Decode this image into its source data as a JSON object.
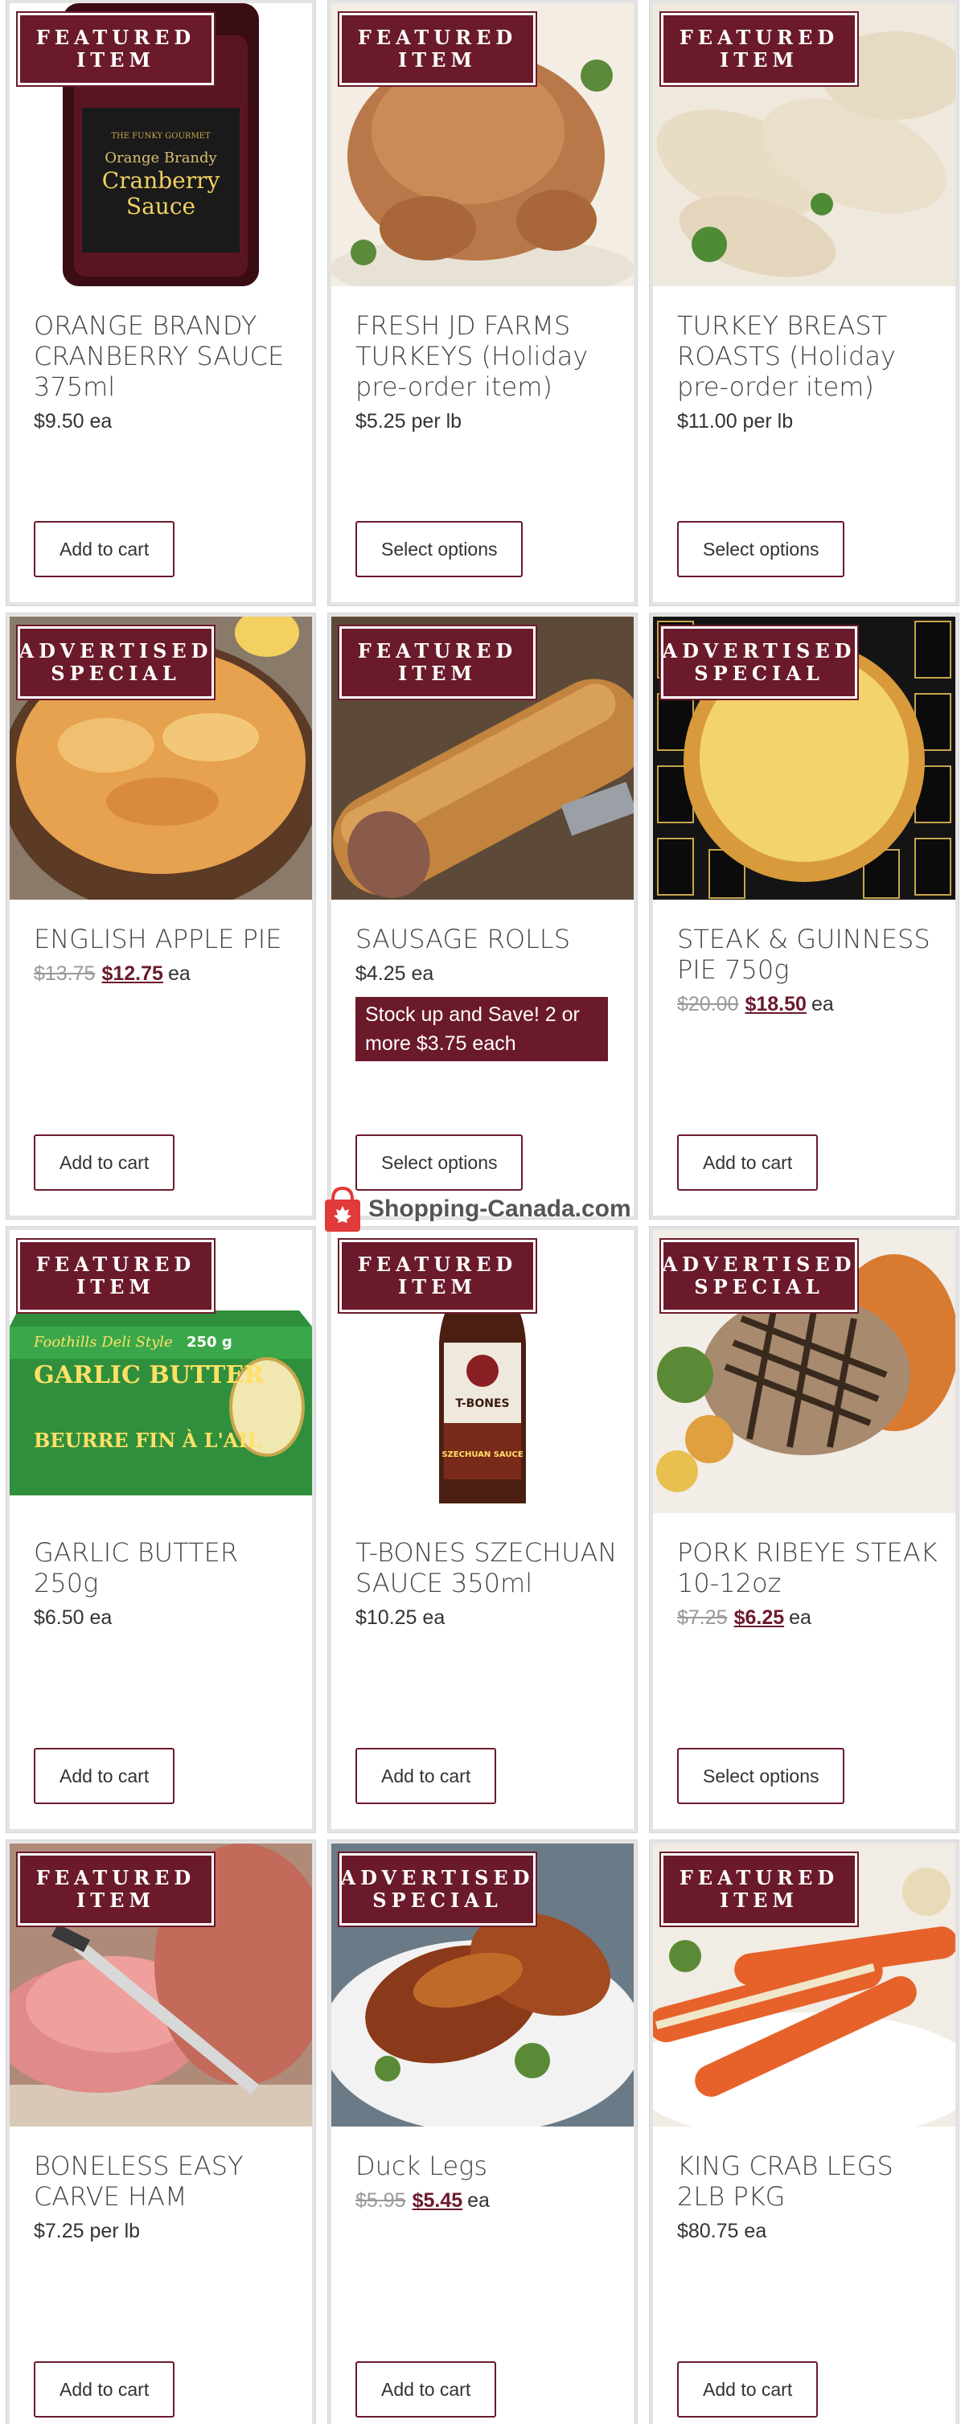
{
  "products": [
    {
      "badge": [
        "FEATURED",
        "ITEM"
      ],
      "title": "ORANGE BRANDY CRANBERRY SAUCE 375ml",
      "price": "$9.50 ea",
      "button": "Add to cart",
      "image": "cranberry-sauce-jar-image",
      "jar_label": [
        "THE FUNKY GOURMET",
        "Orange Brandy",
        "Cranberry",
        "Sauce"
      ]
    },
    {
      "badge": [
        "FEATURED",
        "ITEM"
      ],
      "title": "FRESH JD FARMS TURKEYS (Holiday pre-order item)",
      "price": "$5.25 per lb",
      "button": "Select options",
      "image": "roast-turkey-image"
    },
    {
      "badge": [
        "FEATURED",
        "ITEM"
      ],
      "title": "TURKEY BREAST ROASTS (Holiday pre-order item)",
      "price": "$11.00 per lb",
      "button": "Select options",
      "image": "turkey-breast-roast-image"
    },
    {
      "badge": [
        "ADVERTISED",
        "SPECIAL"
      ],
      "title": "ENGLISH APPLE PIE",
      "old_price": "$13.75",
      "sale_price": "$12.75",
      "unit": "ea",
      "button": "Add to cart",
      "image": "apple-pie-image"
    },
    {
      "badge": [
        "FEATURED",
        "ITEM"
      ],
      "title": "SAUSAGE ROLLS",
      "price": "$4.25 ea",
      "promo": "Stock up and Save! 2 or more $3.75 each",
      "button": "Select options",
      "image": "sausage-roll-image"
    },
    {
      "badge": [
        "ADVERTISED",
        "SPECIAL"
      ],
      "title": "STEAK & GUINNESS PIE 750g",
      "old_price": "$20.00",
      "sale_price": "$18.50",
      "unit": "ea",
      "button": "Add to cart",
      "image": "steak-guinness-pie-image"
    },
    {
      "badge": [
        "FEATURED",
        "ITEM"
      ],
      "title": "GARLIC BUTTER 250g",
      "price": "$6.50 ea",
      "button": "Add to cart",
      "image": "garlic-butter-package-image",
      "package_label": [
        "Foothills Deli Style",
        "GARLIC BUTTER",
        "BEURRE FIN À L'AIL",
        "250 g"
      ]
    },
    {
      "badge": [
        "FEATURED",
        "ITEM"
      ],
      "title": "T-BONES SZECHUAN SAUCE 350ml",
      "price": "$10.25 ea",
      "button": "Add to cart",
      "image": "szechuan-sauce-bottle-image",
      "bottle_label": [
        "T-BONES",
        "SZECHUAN SAUCE"
      ]
    },
    {
      "badge": [
        "ADVERTISED",
        "SPECIAL"
      ],
      "title": "PORK RIBEYE STEAK 10-12oz",
      "old_price": "$7.25",
      "sale_price": "$6.25",
      "unit": "ea",
      "button": "Select options",
      "image": "pork-ribeye-steak-image"
    },
    {
      "badge": [
        "FEATURED",
        "ITEM"
      ],
      "title": "BONELESS EASY CARVE HAM",
      "price": "$7.25 per lb",
      "button": "Add to cart",
      "image": "sliced-ham-image"
    },
    {
      "badge": [
        "ADVERTISED",
        "SPECIAL"
      ],
      "title": "Duck Legs",
      "old_price": "$5.95",
      "sale_price": "$5.45",
      "unit": "ea",
      "button": "Add to cart",
      "image": "duck-legs-image"
    },
    {
      "badge": [
        "FEATURED",
        "ITEM"
      ],
      "title": "KING CRAB LEGS 2LB PKG",
      "price": "$80.75 ea",
      "button": "Add to cart",
      "image": "king-crab-legs-image"
    }
  ],
  "watermark": {
    "text": "Shopping-Canada.com",
    "icon": "shopping-bag-maple-leaf-icon"
  },
  "colors": {
    "brand": "#6b1a2b",
    "card_border": "#e3e3e3",
    "old_price": "#999999"
  }
}
